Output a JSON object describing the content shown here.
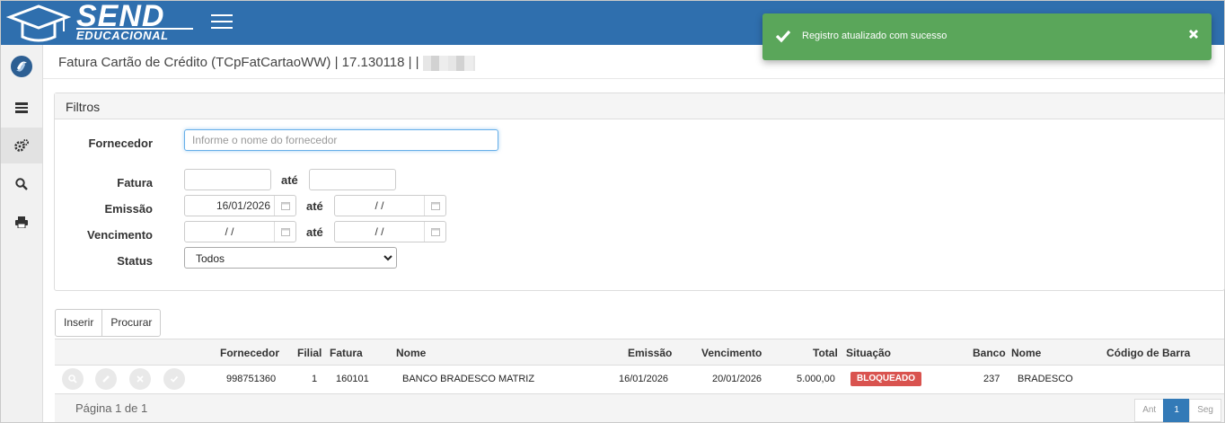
{
  "brand": {
    "name_top": "SEND",
    "name_bottom": "EDUCACIONAL"
  },
  "header": {
    "title": "Fatura Cartão de Crédito (TCpFatCartaoWW) | 17.130118 | |"
  },
  "sidebar": {
    "items": [
      "logo-icon",
      "list-icon",
      "gears-icon",
      "search-icon",
      "print-icon"
    ]
  },
  "filters": {
    "panel_title": "Filtros",
    "fornecedor_label": "Fornecedor",
    "fornecedor_placeholder": "Informe o nome do fornecedor",
    "fatura_label": "Fatura",
    "emissao_label": "Emissão",
    "vencimento_label": "Vencimento",
    "status_label": "Status",
    "ate": "até",
    "fatura_from": "",
    "fatura_to": "",
    "emissao_from": "16/01/2026",
    "emissao_to": "/ /",
    "vencimento_from": "/ /",
    "vencimento_to": "/ /",
    "status_value": "Todos"
  },
  "actions": {
    "insert": "Inserir",
    "search": "Procurar"
  },
  "table": {
    "headers": [
      "Fornecedor",
      "Filial",
      "Fatura",
      "Nome",
      "Emissão",
      "Vencimento",
      "Total",
      "Situação",
      "Banco",
      "Nome",
      "Código de Barra"
    ],
    "rows": [
      {
        "fornecedor": "998751360",
        "filial": "1",
        "fatura": "160101",
        "nome": "BANCO BRADESCO MATRIZ",
        "emissao": "16/01/2026",
        "vencimento": "20/01/2026",
        "total": "5.000,00",
        "situacao": "BLOQUEADO",
        "banco": "237",
        "nome_banco": "BRADESCO",
        "codigo_barra": ""
      }
    ]
  },
  "pagination": {
    "info": "Página 1 de 1",
    "prev": "Ant",
    "current": "1",
    "next": "Seg"
  },
  "toast": {
    "message": "Registro atualizado com sucesso"
  },
  "colors": {
    "header": "#2f6fae",
    "toast": "#5aa65a",
    "badge": "#d9534f",
    "pager_active": "#337ab7"
  }
}
